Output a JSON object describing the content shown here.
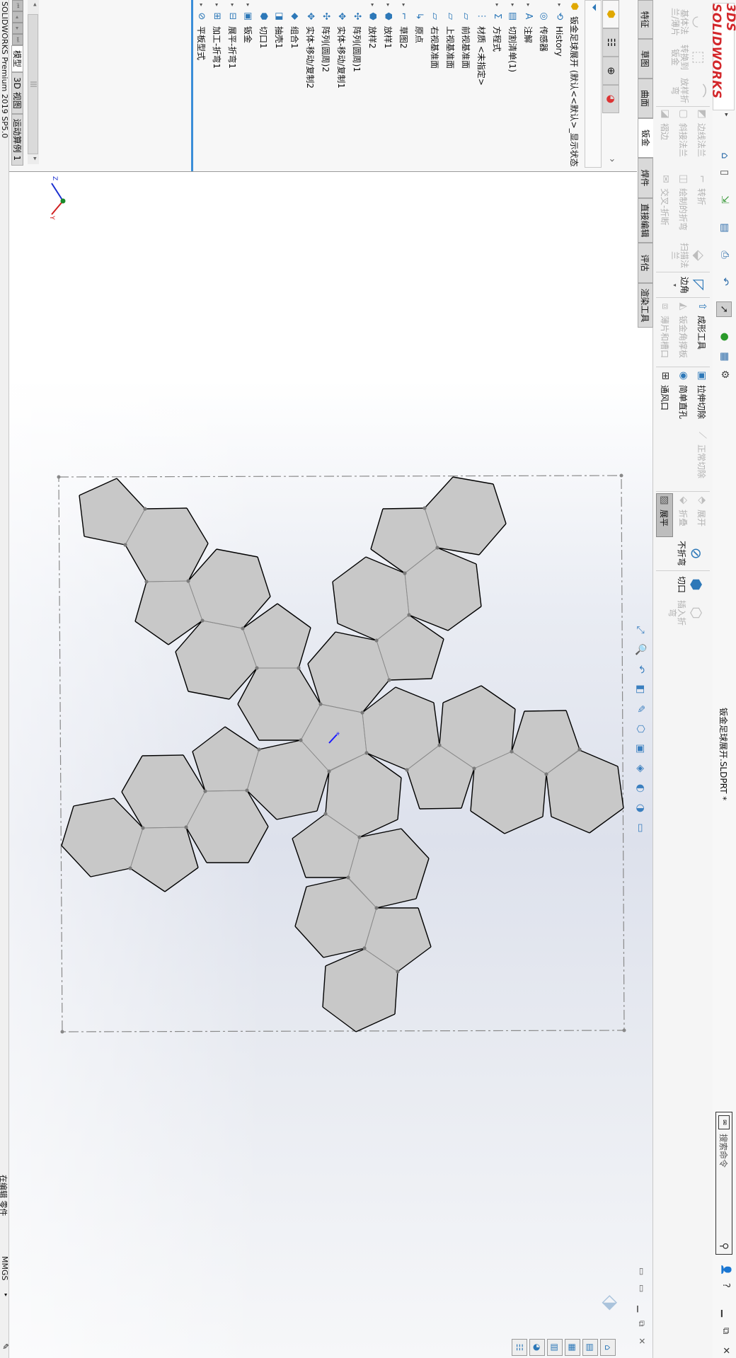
{
  "titlebar": {
    "logo": "3DS SOLIDWORKS",
    "document_title": "钣金足球展开.SLDPRT *",
    "search_placeholder": "搜索命令"
  },
  "quick_access": [
    "home-icon",
    "new-document-icon",
    "open-icon",
    "save-icon",
    "print-icon",
    "undo-icon",
    "select-icon",
    "rebuild-icon",
    "file-properties-icon",
    "options-icon"
  ],
  "ribbon": {
    "base_flange": "基体法兰/薄片",
    "convert_to_sheet_metal": "转换到钣金",
    "lofted_bend": "放样折弯",
    "edge_flange": "边线法兰",
    "miter_flange": "斜接法兰",
    "hem": "褶边",
    "jog": "转折",
    "sketched_bend": "绘制的折弯",
    "cross_break": "交叉-折断",
    "swept_flange": "扫描法兰",
    "corners": "边角",
    "forming_tool": "成形工具",
    "sheet_metal_gusset": "钣金角撑板",
    "tab_and_slot": "薄片和槽口",
    "extruded_cut": "拉伸切除",
    "simple_hole": "简单直孔",
    "vent": "通风口",
    "normal_cut": "正常切除",
    "unfold": "展开",
    "fold": "折叠",
    "flatten": "展平",
    "no_bends": "不折弯",
    "rip": "切口",
    "insert_bends": "插入折弯"
  },
  "tabs": [
    "特征",
    "草图",
    "曲面",
    "钣金",
    "焊件",
    "直接编辑",
    "评估",
    "渲染工具"
  ],
  "active_tab": "钣金",
  "feature_tree": {
    "root": "钣金足球展开  (默认<<默认>_显示状态",
    "items": [
      {
        "label": "History",
        "icon": "history-icon"
      },
      {
        "label": "传感器",
        "icon": "sensor-icon"
      },
      {
        "label": "注解",
        "icon": "annotation-icon"
      },
      {
        "label": "切割清单(1)",
        "icon": "cut-list-icon"
      },
      {
        "label": "方程式",
        "icon": "equation-icon"
      },
      {
        "label": "材质 <未指定>",
        "icon": "material-icon"
      },
      {
        "label": "前视基准面",
        "icon": "plane-icon"
      },
      {
        "label": "上视基准面",
        "icon": "plane-icon"
      },
      {
        "label": "右视基准面",
        "icon": "plane-icon"
      },
      {
        "label": "原点",
        "icon": "origin-icon"
      },
      {
        "label": "草图2",
        "icon": "sketch-icon"
      },
      {
        "label": "放样1",
        "icon": "loft-icon"
      },
      {
        "label": "放样2",
        "icon": "loft-icon"
      },
      {
        "label": "阵列(圆周)1",
        "icon": "circular-pattern-icon"
      },
      {
        "label": "实体-移动/复制1",
        "icon": "move-copy-body-icon"
      },
      {
        "label": "阵列(圆周)2",
        "icon": "circular-pattern-icon"
      },
      {
        "label": "实体-移动/复制2",
        "icon": "move-copy-body-icon"
      },
      {
        "label": "组合1",
        "icon": "combine-icon"
      },
      {
        "label": "抽壳1",
        "icon": "shell-icon"
      },
      {
        "label": "切口1",
        "icon": "rip-icon"
      },
      {
        "label": "钣金",
        "icon": "sheet-metal-icon"
      },
      {
        "label": "展平-折弯1",
        "icon": "flatten-bends-icon"
      },
      {
        "label": "加工-折弯1",
        "icon": "process-bends-icon"
      },
      {
        "label": "平板型式",
        "icon": "flat-pattern-icon"
      }
    ]
  },
  "bottom_tabs": [
    "模型",
    "3D 视图",
    "运动算例 1"
  ],
  "status": {
    "app": "SOLIDWORKS Premium 2019 SP5.0",
    "mode": "在编辑 零件",
    "units": "MMGS"
  },
  "colors": {
    "face_fill": "#c8c8c8",
    "edge": "#000000",
    "bend_line": "#8a8a8a",
    "accent": "#3b8ed8",
    "logo": "#d3272b"
  }
}
